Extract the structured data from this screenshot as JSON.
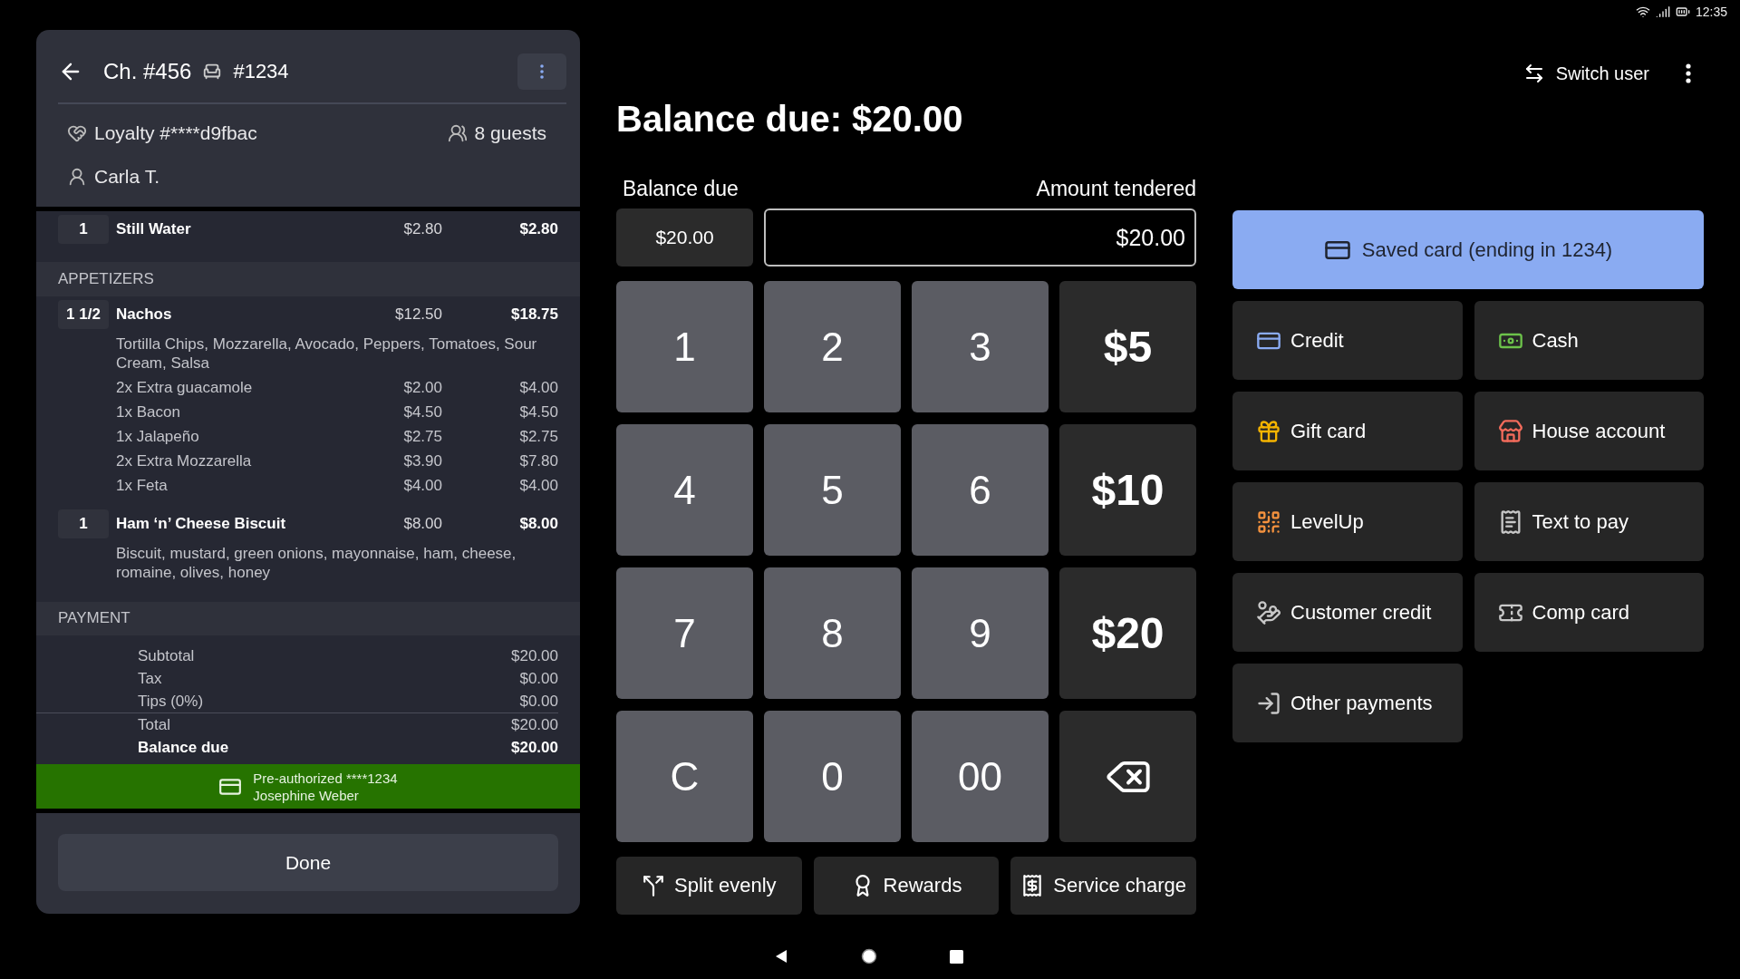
{
  "status_bar": {
    "time": "12:35"
  },
  "check": {
    "title": "Ch. #456",
    "table": "#1234",
    "loyalty": "Loyalty #****d9fbac",
    "guests": "8 guests",
    "server": "Carla T.",
    "lines": [
      {
        "kind": "item",
        "qty": "1",
        "name": "Still Water",
        "price": "$2.80",
        "total": "$2.80"
      },
      {
        "kind": "section",
        "name": "APPETIZERS"
      },
      {
        "kind": "item",
        "qty": "1 1/2",
        "name": "Nachos",
        "price": "$12.50",
        "total": "$18.75",
        "description": "Tortilla Chips, Mozzarella, Avocado, Peppers, Tomatoes, Sour Cream, Salsa",
        "modifiers": [
          {
            "name": "2x Extra guacamole",
            "price": "$2.00",
            "total": "$4.00"
          },
          {
            "name": "1x Bacon",
            "price": "$4.50",
            "total": "$4.50"
          },
          {
            "name": "1x Jalapeño",
            "price": "$2.75",
            "total": "$2.75"
          },
          {
            "name": "2x Extra Mozzarella",
            "price": "$3.90",
            "total": "$7.80"
          },
          {
            "name": "1x Feta",
            "price": "$4.00",
            "total": "$4.00"
          }
        ]
      },
      {
        "kind": "item",
        "qty": "1",
        "name": "Ham ‘n’ Cheese Biscuit",
        "price": "$8.00",
        "total": "$8.00",
        "description": "Biscuit, mustard, green onions, mayonnaise, ham, cheese, romaine, olives, honey"
      },
      {
        "kind": "section",
        "name": "PAYMENT"
      }
    ],
    "summary": [
      {
        "label": "Subtotal",
        "value": "$20.00",
        "divider_before": false,
        "bold": false
      },
      {
        "label": "Tax",
        "value": "$0.00",
        "divider_before": false,
        "bold": false
      },
      {
        "label": "Tips (0%)",
        "value": "$0.00",
        "divider_before": false,
        "bold": false
      },
      {
        "label": "Total",
        "value": "$20.00",
        "divider_before": true,
        "bold": false
      },
      {
        "label": "Balance due",
        "value": "$20.00",
        "divider_before": false,
        "bold": true
      }
    ],
    "preauth": {
      "line1": "Pre-authorized ****1234",
      "line2": "Josephine Weber"
    },
    "done": "Done"
  },
  "payment": {
    "title": "Balance due: $20.00",
    "balance_label": "Balance due",
    "tendered_label": "Amount tendered",
    "balance_value": "$20.00",
    "tendered_value": "$20.00",
    "keys": [
      {
        "kind": "digit",
        "label": "1"
      },
      {
        "kind": "digit",
        "label": "2"
      },
      {
        "kind": "digit",
        "label": "3"
      },
      {
        "kind": "amount",
        "label": "$5"
      },
      {
        "kind": "digit",
        "label": "4"
      },
      {
        "kind": "digit",
        "label": "5"
      },
      {
        "kind": "digit",
        "label": "6"
      },
      {
        "kind": "amount",
        "label": "$10"
      },
      {
        "kind": "digit",
        "label": "7"
      },
      {
        "kind": "digit",
        "label": "8"
      },
      {
        "kind": "digit",
        "label": "9"
      },
      {
        "kind": "amount",
        "label": "$20"
      },
      {
        "kind": "digit",
        "label": "C"
      },
      {
        "kind": "digit",
        "label": "0"
      },
      {
        "kind": "digit",
        "label": "00"
      },
      {
        "kind": "backspace"
      }
    ],
    "actions": [
      {
        "label": "Split evenly"
      },
      {
        "label": "Rewards"
      },
      {
        "label": "Service charge"
      }
    ]
  },
  "top_bar": {
    "switch_user": "Switch user"
  },
  "saved_card": {
    "label": "Saved card (ending in 1234)"
  },
  "tenders": [
    {
      "label": "Credit",
      "color": "#8aabf2"
    },
    {
      "label": "Cash",
      "color": "#6cc24a"
    },
    {
      "label": "Gift card",
      "color": "#f5b400"
    },
    {
      "label": "House account",
      "color": "#f26b5b"
    },
    {
      "label": "LevelUp",
      "color": "#f5923e"
    },
    {
      "label": "Text to pay",
      "color": "#c8c8c8"
    },
    {
      "label": "Customer credit",
      "color": "#c8c8c8"
    },
    {
      "label": "Comp card",
      "color": "#c8c8c8"
    },
    {
      "label": "Other payments",
      "color": "#c8c8c8"
    }
  ]
}
